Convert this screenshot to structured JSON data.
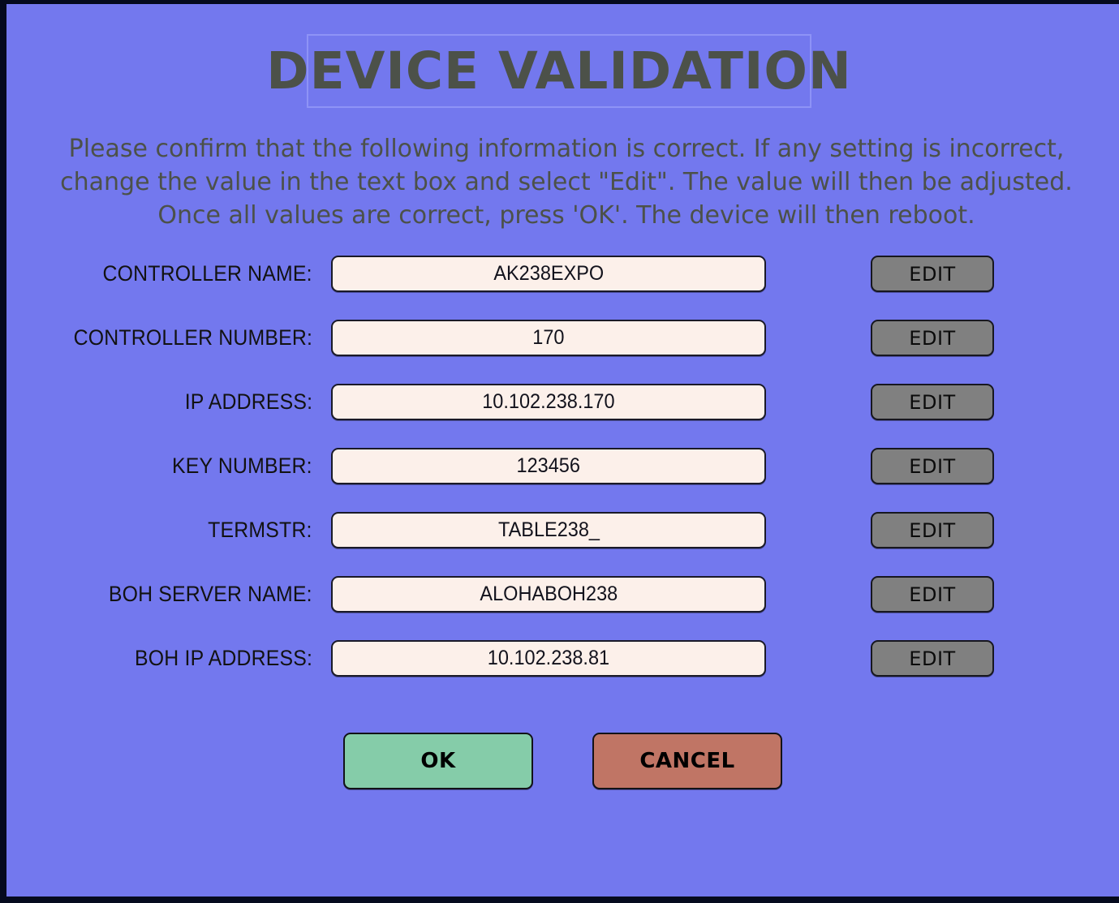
{
  "window": {
    "background_color": "#7378EE",
    "frame_color": "#050A1E"
  },
  "header": {
    "title": "DEVICE VALIDATION",
    "title_color": "#4C5149",
    "title_border_color": "#8E93F6"
  },
  "instructions": {
    "text": "Please confirm that the following information is correct. If any setting is incorrect, change the value in the text box and select \"Edit\". The value will then be adjusted. Once all values are correct, press 'OK'. The device will then reboot.",
    "color": "#4C5149"
  },
  "form": {
    "edit_label": "EDIT",
    "input_background": "#FCF0EA",
    "button_background": "#808080",
    "rows": [
      {
        "label": "CONTROLLER NAME:",
        "value": "AK238EXPO",
        "edit": "EDIT"
      },
      {
        "label": "CONTROLLER NUMBER:",
        "value": "170",
        "edit": "EDIT"
      },
      {
        "label": "IP ADDRESS:",
        "value": "10.102.238.170",
        "edit": "EDIT"
      },
      {
        "label": "KEY NUMBER:",
        "value": "123456",
        "edit": "EDIT"
      },
      {
        "label": "TERMSTR:",
        "value": "TABLE238_",
        "edit": "EDIT"
      },
      {
        "label": "BOH SERVER NAME:",
        "value": "ALOHABOH238",
        "edit": "EDIT"
      },
      {
        "label": "BOH IP ADDRESS:",
        "value": "10.102.238.81",
        "edit": "EDIT"
      }
    ]
  },
  "actions": {
    "ok_label": "OK",
    "ok_color": "#85CCA9",
    "cancel_label": "CANCEL",
    "cancel_color": "#C07565"
  }
}
